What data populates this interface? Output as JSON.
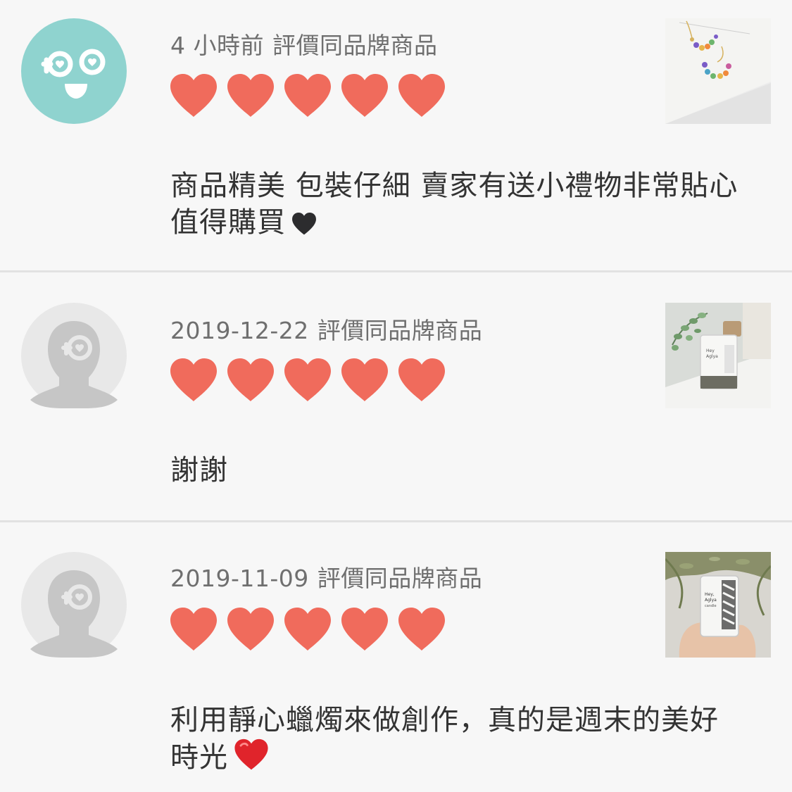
{
  "colors": {
    "background": "#f7f7f7",
    "divider": "#e2e2e2",
    "heart": "#f06b5c",
    "avatar_teal": "#8fd3cf",
    "avatar_gray": "#e8e8e8",
    "meta_text": "#6f6f6f",
    "comment_text": "#333333"
  },
  "reviews": [
    {
      "time": "4 小時前",
      "label": "評價同品牌商品",
      "rating": 5,
      "comment_lines": [
        "商品精美 包裝仔細 賣家有送小禮物非常貼心",
        "值得購買"
      ],
      "trailing_emoji": "black-heart-icon",
      "avatar": "teal-face-avatar",
      "thumbnail": "earrings-photo"
    },
    {
      "time": "2019-12-22",
      "label": "評價同品牌商品",
      "rating": 5,
      "comment_lines": [
        "謝謝"
      ],
      "avatar": "default-person-avatar",
      "thumbnail": "candle-eucalyptus-photo"
    },
    {
      "time": "2019-11-09",
      "label": "評價同品牌商品",
      "rating": 5,
      "comment_lines": [
        "利用靜心蠟燭來做創作，真的是週末的美好",
        "時光"
      ],
      "trailing_emoji": "red-heart-icon",
      "avatar": "default-person-avatar",
      "thumbnail": "candle-in-hand-photo"
    }
  ]
}
